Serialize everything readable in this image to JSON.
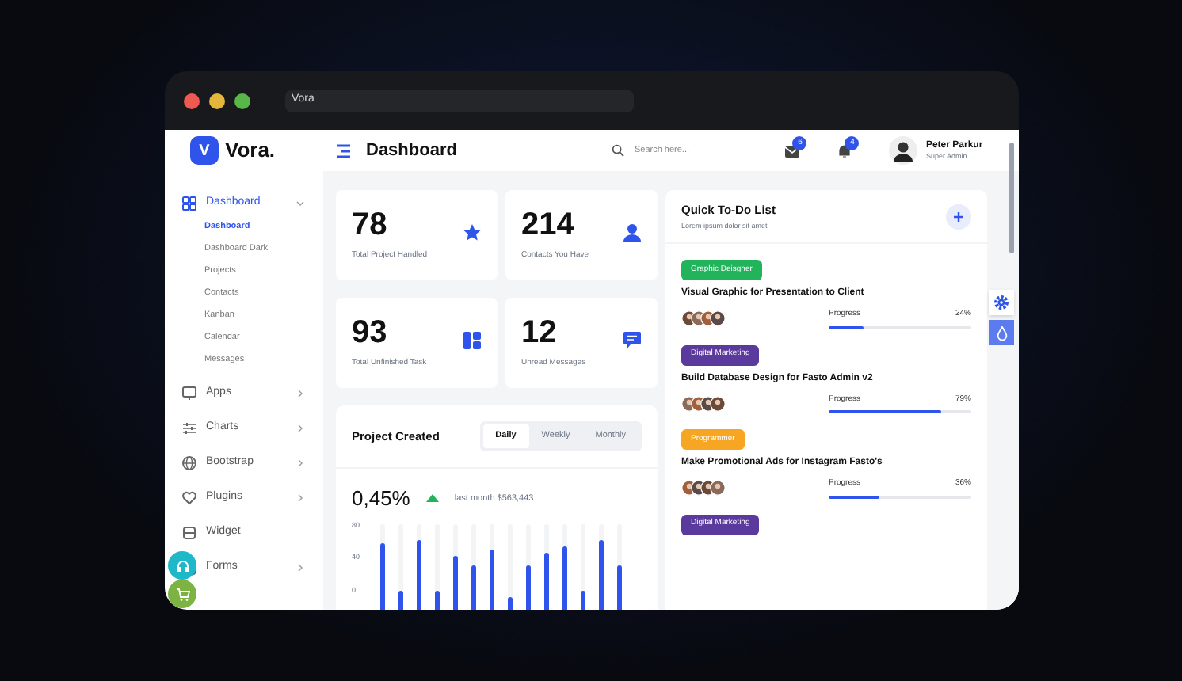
{
  "browser": {
    "address": "Vora"
  },
  "brand": {
    "logo_letter": "V",
    "name": "Vora."
  },
  "header": {
    "title": "Dashboard",
    "search_placeholder": "Search here...",
    "mail_count": "6",
    "bell_count": "4",
    "user_name": "Peter Parkur",
    "user_role": "Super Admin"
  },
  "sidebar": {
    "items": [
      {
        "label": "Dashboard",
        "expanded": true,
        "selected": true,
        "children": [
          {
            "label": "Dashboard",
            "selected": true
          },
          {
            "label": "Dashboard Dark",
            "selected": false
          },
          {
            "label": "Projects",
            "selected": false
          },
          {
            "label": "Contacts",
            "selected": false
          },
          {
            "label": "Kanban",
            "selected": false
          },
          {
            "label": "Calendar",
            "selected": false
          },
          {
            "label": "Messages",
            "selected": false
          }
        ]
      },
      {
        "label": "Apps",
        "expanded": false,
        "selected": false
      },
      {
        "label": "Charts",
        "expanded": false,
        "selected": false
      },
      {
        "label": "Bootstrap",
        "expanded": false,
        "selected": false
      },
      {
        "label": "Plugins",
        "expanded": false,
        "selected": false
      },
      {
        "label": "Widget",
        "selected": false
      },
      {
        "label": "Forms",
        "expanded": false,
        "selected": false
      }
    ]
  },
  "stats": [
    {
      "value": "78",
      "label": "Total Project Handled"
    },
    {
      "value": "214",
      "label": "Contacts You Have"
    },
    {
      "value": "93",
      "label": "Total Unfinished Task"
    },
    {
      "value": "12",
      "label": "Unread Messages"
    }
  ],
  "project_chart": {
    "title": "Project Created",
    "tabs": [
      {
        "label": "Daily",
        "selected": true
      },
      {
        "label": "Weekly",
        "selected": false
      },
      {
        "label": "Monthly",
        "selected": false
      }
    ],
    "percent": "0,45%",
    "trend": "last month $563,443",
    "y_labels": [
      "80",
      "40",
      "0"
    ]
  },
  "todo": {
    "title": "Quick To-Do List",
    "subtitle": "Lorem ipsum dolor sit amet",
    "items": [
      {
        "tag": "Graphic Deisgner",
        "color": "#22b45a",
        "title": "Visual Graphic for Presentation to Client",
        "progress_label": "Progress",
        "reading": "24%",
        "level": 0.24
      },
      {
        "tag": "Digital Marketing",
        "color": "#5b3a9e",
        "title": "Build Database Design for Fasto Admin v2",
        "progress_label": "Progress",
        "reading": "79%",
        "level": 0.79
      },
      {
        "tag": "Programmer",
        "color": "#f6a623",
        "title": "Make Promotional Ads for Instagram Fasto's",
        "progress_label": "Progress",
        "reading": "36%",
        "level": 0.36
      },
      {
        "tag": "Digital Marketing",
        "color": "#5b3a9e"
      }
    ]
  }
}
